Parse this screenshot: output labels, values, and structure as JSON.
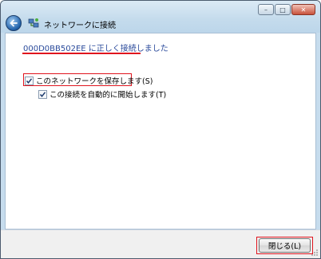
{
  "window": {
    "title": "ネットワークに接続",
    "controls": {
      "minimize": "–",
      "maximize": "□",
      "close": "✕"
    }
  },
  "content": {
    "success_message": "000D0BB502EE に正しく接続しました",
    "save_network": {
      "label": "このネットワークを保存します(S)",
      "checked": true
    },
    "auto_connect": {
      "label": "この接続を自動的に開始します(T)",
      "checked": true
    }
  },
  "footer": {
    "close_label": "閉じる(L)"
  },
  "colors": {
    "highlight": "#e0141e",
    "link_text": "#2a4a9b",
    "window_frame": "#c6dced"
  }
}
